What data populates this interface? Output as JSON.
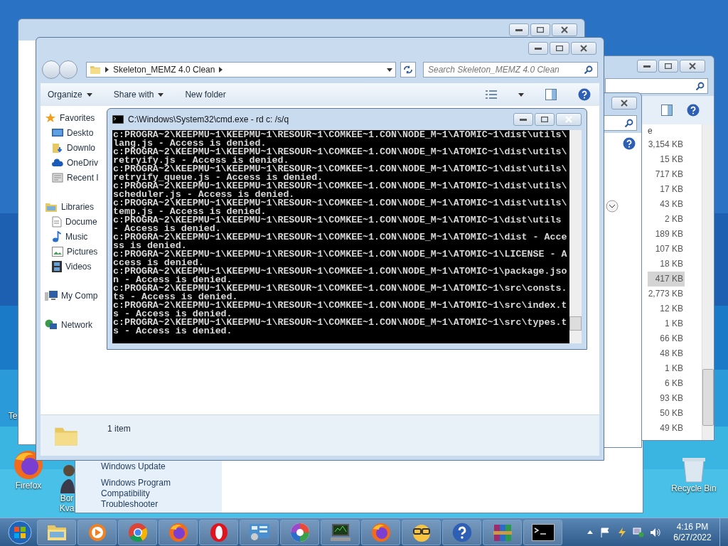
{
  "desktop_icons": [
    {
      "kind": "firefox",
      "lines": [
        "Firefox"
      ]
    },
    {
      "kind": "person",
      "lines": [
        "Bor",
        "Kva"
      ]
    },
    {
      "kind": "blank",
      "lines": [
        "Te"
      ]
    },
    {
      "kind": "recycle",
      "lines": [
        "Recycle Bin"
      ]
    }
  ],
  "troubleshooter_window": {
    "links": [
      "Windows Update",
      "Windows Program Compatibility Troubleshooter"
    ]
  },
  "files_window": {
    "column_header": "e",
    "sizes": [
      {
        "text": "3,154 KB",
        "selected": false
      },
      {
        "text": "15 KB",
        "selected": false
      },
      {
        "text": "717 KB",
        "selected": false
      },
      {
        "text": "17 KB",
        "selected": false
      },
      {
        "text": "43 KB",
        "selected": false
      },
      {
        "text": "2 KB",
        "selected": false
      },
      {
        "text": "189 KB",
        "selected": false
      },
      {
        "text": "107 KB",
        "selected": false
      },
      {
        "text": "18 KB",
        "selected": false
      },
      {
        "text": "417 KB",
        "selected": true
      },
      {
        "text": "2,773 KB",
        "selected": false
      },
      {
        "text": "12 KB",
        "selected": false
      },
      {
        "text": "1 KB",
        "selected": false
      },
      {
        "text": "66 KB",
        "selected": false
      },
      {
        "text": "48 KB",
        "selected": false
      },
      {
        "text": "1 KB",
        "selected": false
      },
      {
        "text": "6 KB",
        "selected": false
      },
      {
        "text": "93 KB",
        "selected": false
      },
      {
        "text": "50 KB",
        "selected": false
      },
      {
        "text": "49 KB",
        "selected": false
      }
    ]
  },
  "explorer": {
    "breadcrumb": "Skeleton_MEMZ 4.0 Clean",
    "search_placeholder": "Search Skeleton_MEMZ 4.0 Clean",
    "toolbar": [
      {
        "label": "Organize",
        "has_menu": true
      },
      {
        "label": "Share with",
        "has_menu": true
      },
      {
        "label": "New folder",
        "has_menu": false
      }
    ],
    "nav": [
      {
        "label": "Favorites",
        "kind": "star",
        "children": [
          {
            "label": "Deskto",
            "kind": "desktop"
          },
          {
            "label": "Downlo",
            "kind": "download"
          },
          {
            "label": "OneDriv",
            "kind": "cloud"
          },
          {
            "label": "Recent I",
            "kind": "recent"
          }
        ]
      },
      {
        "label": "Libraries",
        "kind": "library",
        "children": [
          {
            "label": "Docume",
            "kind": "document"
          },
          {
            "label": "Music",
            "kind": "music"
          },
          {
            "label": "Pictures",
            "kind": "pictures"
          },
          {
            "label": "Videos",
            "kind": "video"
          }
        ]
      },
      {
        "label": "My Comp",
        "kind": "computer"
      },
      {
        "label": "Network",
        "kind": "network"
      }
    ],
    "status": "1 item"
  },
  "cmd": {
    "title": "C:\\Windows\\System32\\cmd.exe - rd  c: /s/q",
    "lines": [
      "c:PROGRA~2\\KEEPMU~1\\KEEPMU~1\\RESOUR~1\\COMKEE~1.CON\\NODE_M~1\\ATOMIC~1\\dist\\utils\\",
      "lang.js - Access is denied.",
      "c:PROGRA~2\\KEEPMU~1\\KEEPMU~1\\RESOUR~1\\COMKEE~1.CON\\NODE_M~1\\ATOMIC~1\\dist\\utils\\",
      "retryify.js - Access is denied.",
      "c:PROGRA~2\\KEEPMU~1\\KEEPMU~1\\RESOUR~1\\COMKEE~1.CON\\NODE_M~1\\ATOMIC~1\\dist\\utils\\",
      "retryify_queue.js - Access is denied.",
      "c:PROGRA~2\\KEEPMU~1\\KEEPMU~1\\RESOUR~1\\COMKEE~1.CON\\NODE_M~1\\ATOMIC~1\\dist\\utils\\",
      "scheduler.js - Access is denied.",
      "c:PROGRA~2\\KEEPMU~1\\KEEPMU~1\\RESOUR~1\\COMKEE~1.CON\\NODE_M~1\\ATOMIC~1\\dist\\utils\\",
      "temp.js - Access is denied.",
      "c:PROGRA~2\\KEEPMU~1\\KEEPMU~1\\RESOUR~1\\COMKEE~1.CON\\NODE_M~1\\ATOMIC~1\\dist\\utils",
      "- Access is denied.",
      "c:PROGRA~2\\KEEPMU~1\\KEEPMU~1\\RESOUR~1\\COMKEE~1.CON\\NODE_M~1\\ATOMIC~1\\dist - Acce",
      "ss is denied.",
      "c:PROGRA~2\\KEEPMU~1\\KEEPMU~1\\RESOUR~1\\COMKEE~1.CON\\NODE_M~1\\ATOMIC~1\\LICENSE - A",
      "ccess is denied.",
      "c:PROGRA~2\\KEEPMU~1\\KEEPMU~1\\RESOUR~1\\COMKEE~1.CON\\NODE_M~1\\ATOMIC~1\\package.jso",
      "n - Access is denied.",
      "c:PROGRA~2\\KEEPMU~1\\KEEPMU~1\\RESOUR~1\\COMKEE~1.CON\\NODE_M~1\\ATOMIC~1\\src\\consts.",
      "ts - Access is denied.",
      "c:PROGRA~2\\KEEPMU~1\\KEEPMU~1\\RESOUR~1\\COMKEE~1.CON\\NODE_M~1\\ATOMIC~1\\src\\index.t",
      "s - Access is denied.",
      "c:PROGRA~2\\KEEPMU~1\\KEEPMU~1\\RESOUR~1\\COMKEE~1.CON\\NODE_M~1\\ATOMIC~1\\src\\types.t",
      "s - Access is denied."
    ]
  },
  "taskbar": {
    "buttons": [
      {
        "kind": "folder"
      },
      {
        "kind": "media"
      },
      {
        "kind": "chrome"
      },
      {
        "kind": "firefox"
      },
      {
        "kind": "opera"
      },
      {
        "kind": "panel"
      },
      {
        "kind": "pinwheel"
      },
      {
        "kind": "monitor"
      },
      {
        "kind": "firefox"
      },
      {
        "kind": "nerd"
      },
      {
        "kind": "help"
      },
      {
        "kind": "archive"
      },
      {
        "kind": "console"
      }
    ],
    "time": "4:16 PM",
    "date": "6/27/2022"
  }
}
